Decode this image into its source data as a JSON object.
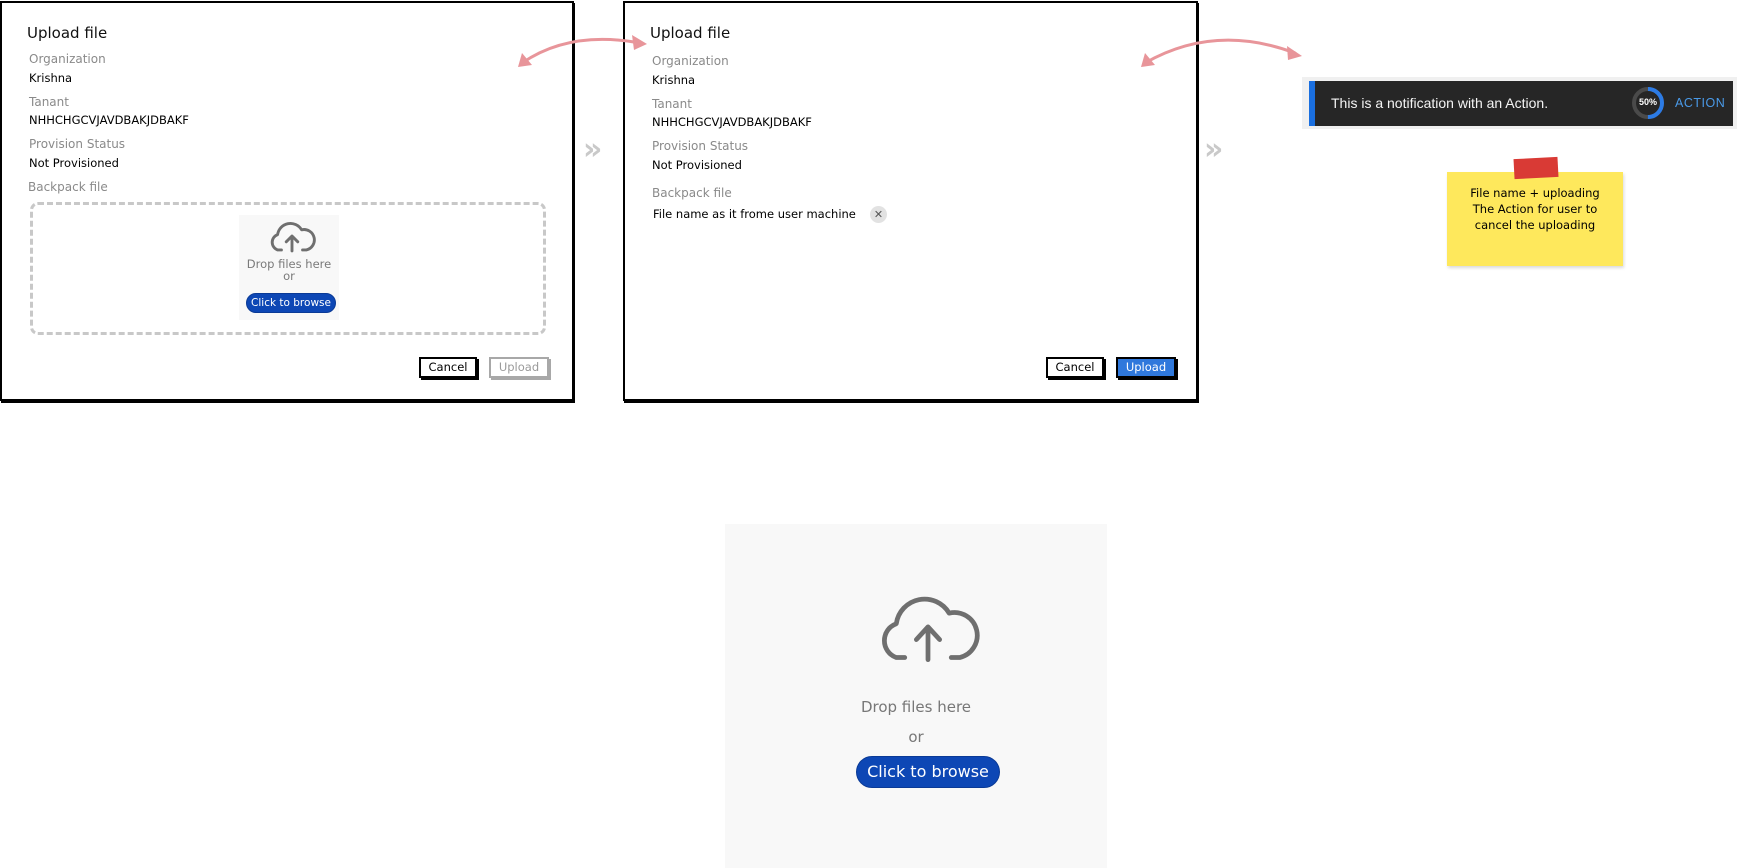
{
  "dialog_empty": {
    "title": "Upload file",
    "organization_label": "Organization",
    "organization_value": "Krishna",
    "tenant_label": "Tanant",
    "tenant_value": "NHHCHGCVJAVDBAKJDBAKF",
    "provision_label": "Provision Status",
    "provision_value": "Not Provisioned",
    "file_label": "Backpack file",
    "dropzone": {
      "icon": "cloud-upload-icon",
      "drop_text": "Drop files here",
      "or_text": "or",
      "browse_label": "Click to browse"
    },
    "cancel_label": "Cancel",
    "upload_label": "Upload",
    "upload_state": "disabled"
  },
  "dialog_selected": {
    "title": "Upload file",
    "organization_label": "Organization",
    "organization_value": "Krishna",
    "tenant_label": "Tanant",
    "tenant_value": "NHHCHGCVJAVDBAKJDBAKF",
    "provision_label": "Provision Status",
    "provision_value": "Not Provisioned",
    "file_label": "Backpack file",
    "file_name": "File name as it frome user machine",
    "remove_icon": "close-icon",
    "cancel_label": "Cancel",
    "upload_label": "Upload",
    "upload_state": "enabled"
  },
  "flow": {
    "chevron_icon": "double-chevron-right-icon",
    "chevron_glyph": "»",
    "arrow_icon": "curved-double-arrow-icon"
  },
  "notification": {
    "message": "This is a notification with an Action.",
    "progress_percent": 50,
    "progress_label": "50%",
    "action_label": "ACTION"
  },
  "sticky_note": {
    "text": "File name + uploading\nThe Action for user to\ncancel the uploading"
  },
  "dropzone_preview": {
    "icon": "cloud-upload-icon",
    "drop_text": "Drop files here",
    "or_text": "or",
    "browse_label": "Click to browse"
  },
  "colors": {
    "primary_button": "#2f78dc",
    "browse_button": "#0d47b5",
    "toast_background": "#262626",
    "toast_accent": "#1a6fe0",
    "action_text": "#4a9ae8",
    "arrow": "#e8959a",
    "sticky": "#fee85c"
  }
}
